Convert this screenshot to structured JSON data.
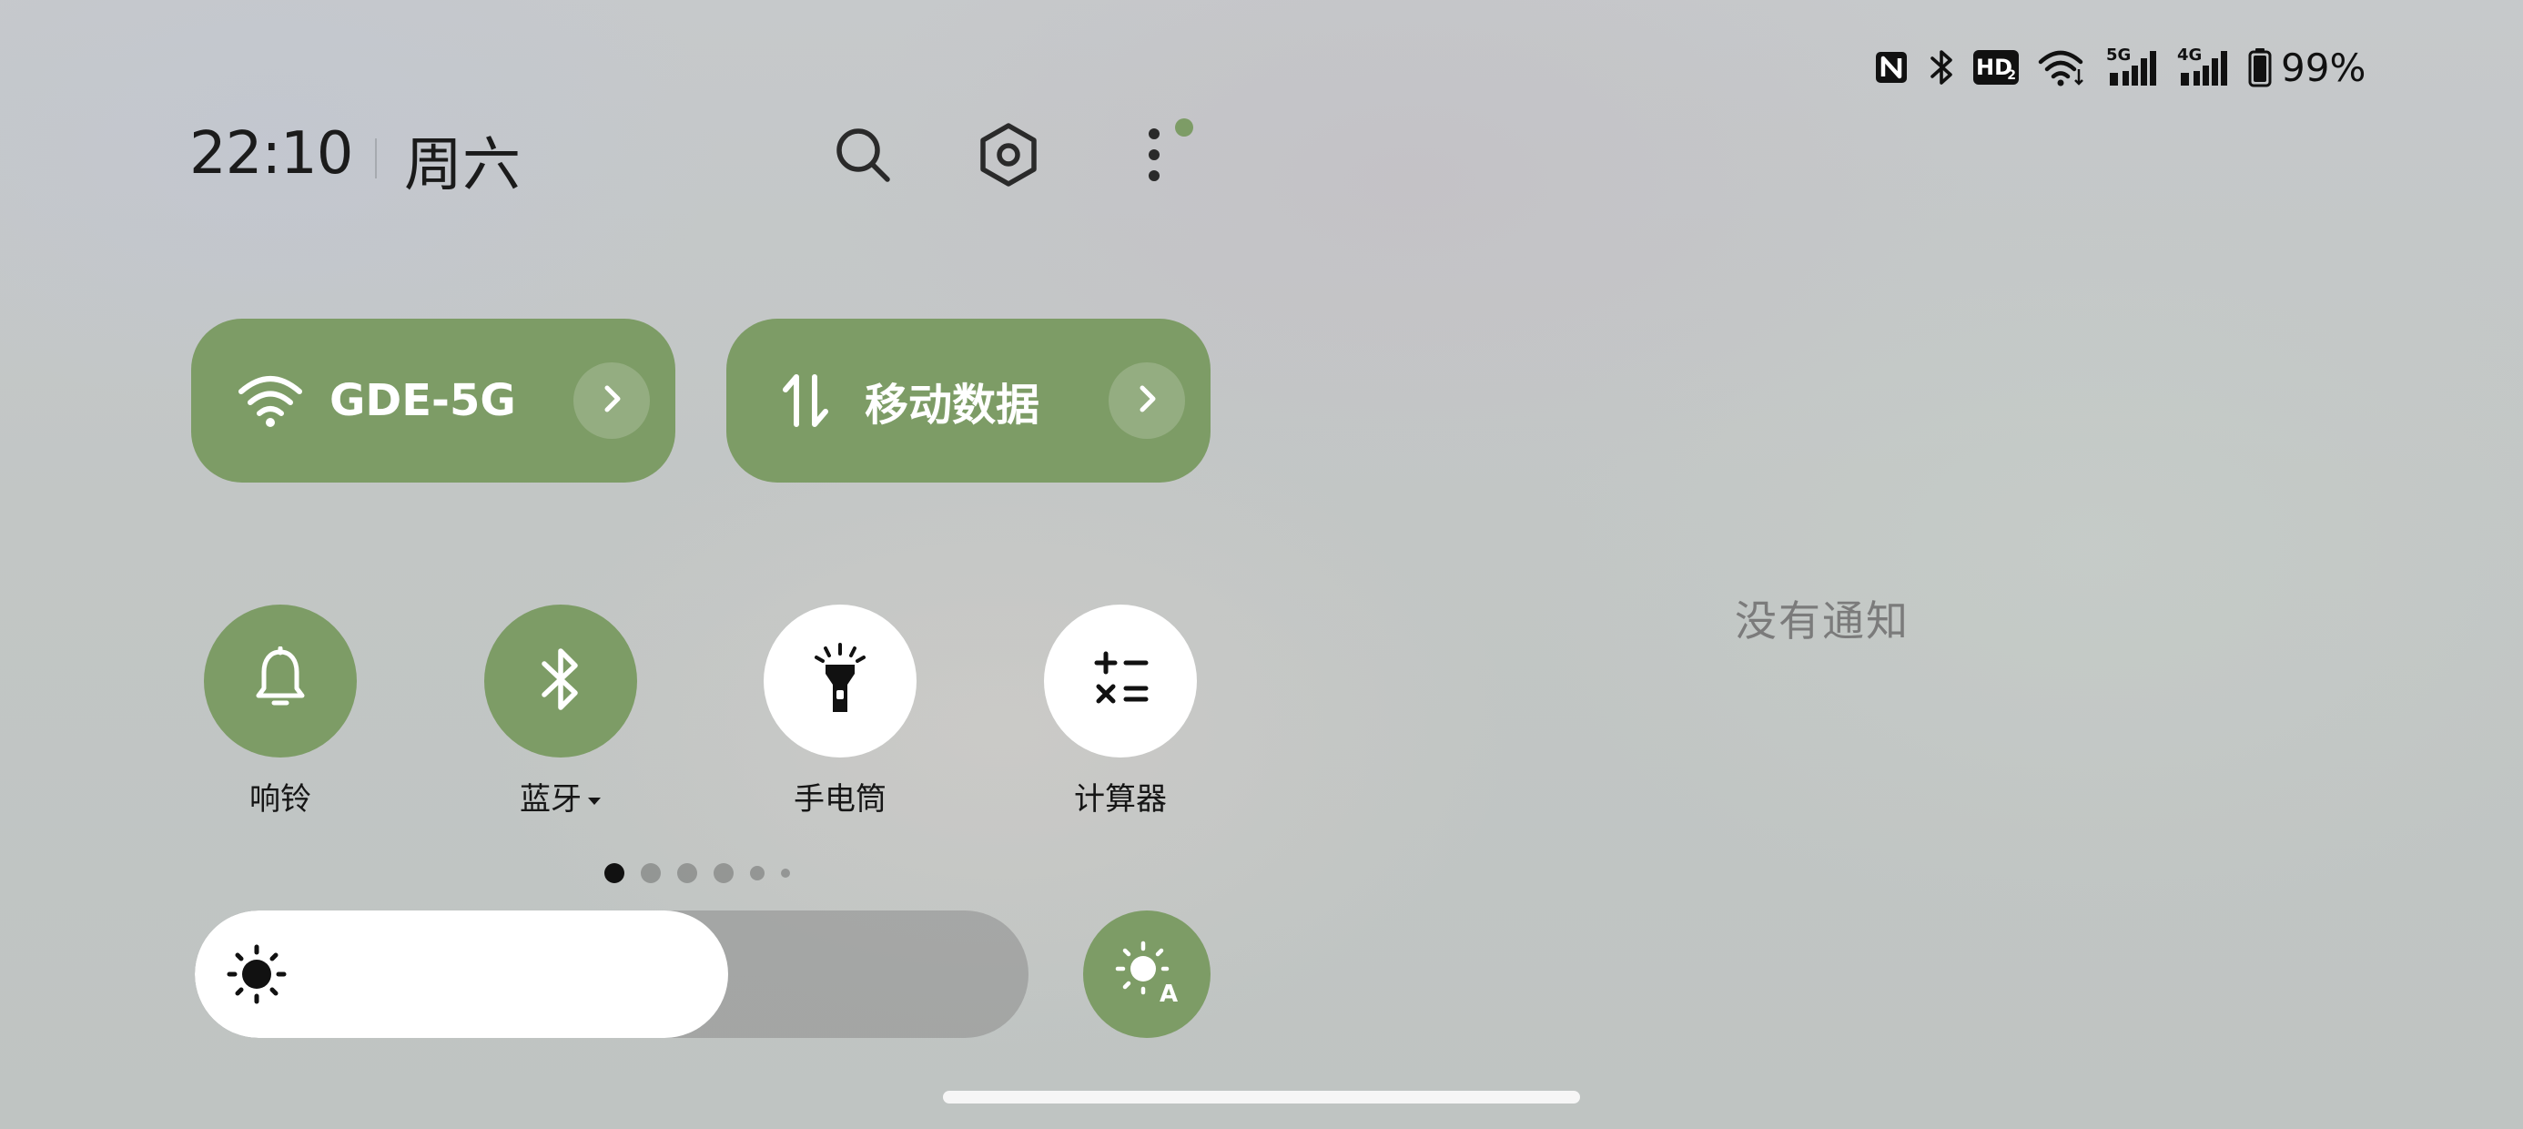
{
  "status_bar": {
    "icons": [
      "nfc-icon",
      "bluetooth-icon",
      "hd-voice-icon",
      "wifi-icon",
      "signal-5g-icon",
      "signal-4g-icon",
      "battery-icon"
    ],
    "hd_text": "HD",
    "network_5g": "5G",
    "network_4g": "4G",
    "battery_percent": "99%"
  },
  "header": {
    "time": "22:10",
    "weekday": "周六",
    "actions": [
      "search-icon",
      "settings-icon",
      "more-icon"
    ]
  },
  "tiles": {
    "wifi": {
      "label": "GDE-5G",
      "icon": "wifi-icon"
    },
    "mobile_data": {
      "label": "移动数据",
      "icon": "mobile-data-icon"
    }
  },
  "quick_settings": {
    "ring": {
      "label": "响铃",
      "icon": "bell-icon",
      "state": "on"
    },
    "bluetooth": {
      "label": "蓝牙",
      "icon": "bluetooth-icon",
      "state": "on"
    },
    "flashlight": {
      "label": "手电筒",
      "icon": "flashlight-icon",
      "state": "off"
    },
    "calculator": {
      "label": "计算器",
      "icon": "calculator-icon",
      "state": "off"
    }
  },
  "pager": {
    "pages": 6,
    "current": 1
  },
  "brightness": {
    "level": 0.64,
    "auto": true
  },
  "notifications": {
    "empty_text": "没有通知"
  },
  "colors": {
    "accent": "#7d9c66",
    "tile_off": "#ffffff"
  }
}
